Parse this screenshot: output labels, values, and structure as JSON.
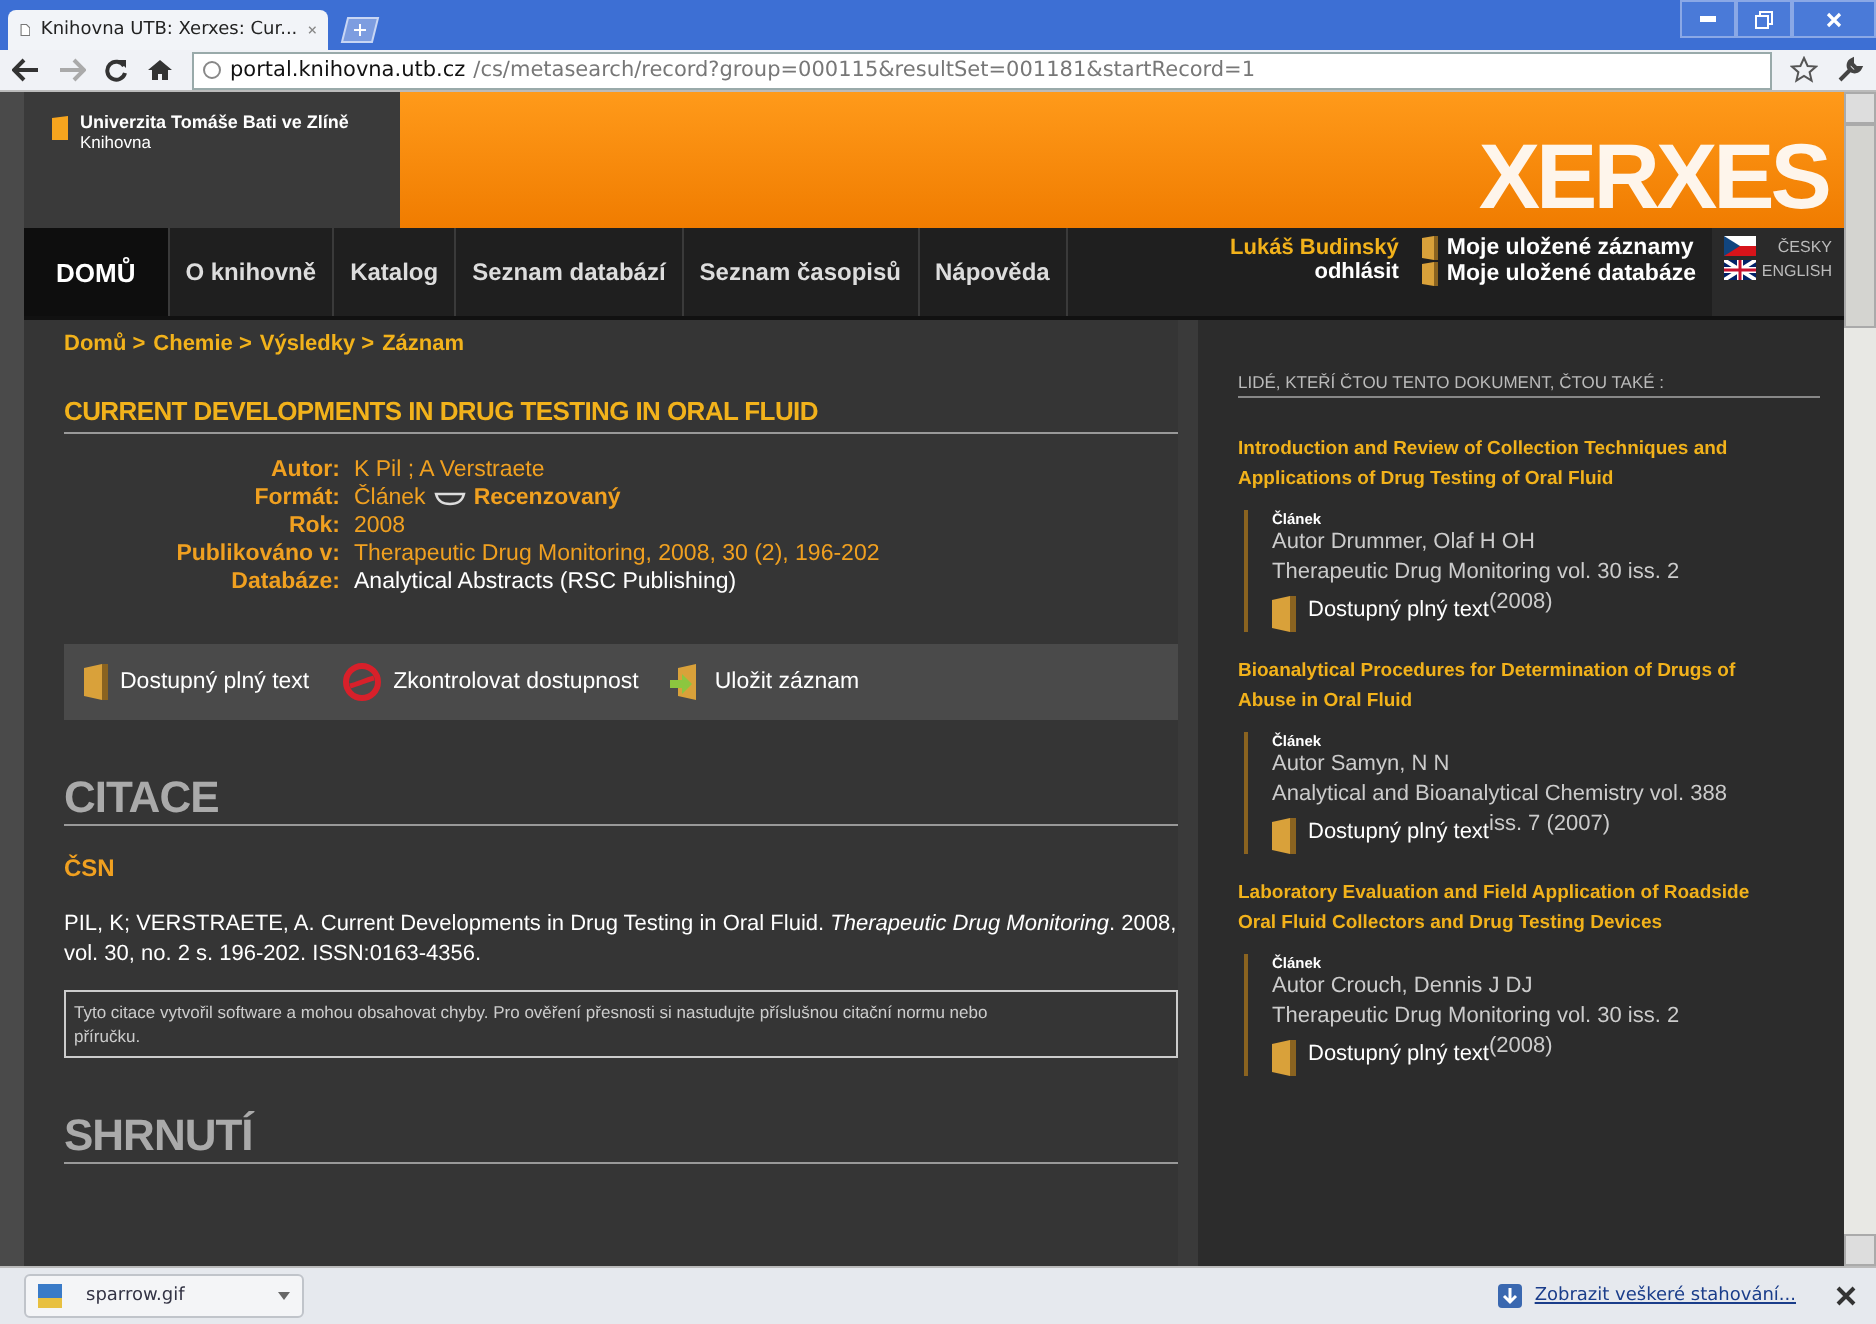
{
  "browser": {
    "tab_title": "Knihovna UTB: Xerxes: Cur...",
    "url_host": "portal.knihovna.utb.cz",
    "url_path": "/cs/metasearch/record?group=000115&resultSet=001181&startRecord=1"
  },
  "header": {
    "institution": "Univerzita Tomáše Bati ve Zlíně",
    "library": "Knihovna",
    "logo": "XERXES"
  },
  "nav": [
    {
      "label": "DOMŮ",
      "selected": true
    },
    {
      "label": "O knihovně",
      "selected": false
    },
    {
      "label": "Katalog",
      "selected": false
    },
    {
      "label": "Seznam databází",
      "selected": false
    },
    {
      "label": "Seznam časopisů",
      "selected": false
    },
    {
      "label": "Nápověda",
      "selected": false
    }
  ],
  "user": {
    "name": "Lukáš Budinský",
    "logout": "odhlásit",
    "saved_records": "Moje uložené záznamy",
    "saved_databases": "Moje uložené databáze"
  },
  "languages": [
    {
      "label": "ČESKY",
      "kind": "cz"
    },
    {
      "label": "ENGLISH",
      "kind": "uk"
    }
  ],
  "breadcrumb": [
    "Domů >",
    "Chemie >",
    "Výsledky >",
    "Záznam"
  ],
  "record": {
    "title": "CURRENT DEVELOPMENTS IN DRUG TESTING IN ORAL FLUID",
    "fields": [
      {
        "label": "Autor:",
        "value": "K Pil ; A Verstraete",
        "kind": "link"
      },
      {
        "label": "Formát:",
        "value": "Článek",
        "extra": "Recenzovaný",
        "kind": "format"
      },
      {
        "label": "Rok:",
        "value": "2008",
        "kind": "link"
      },
      {
        "label": "Publikováno v:",
        "value": "Therapeutic Drug Monitoring, 2008, 30 (2), 196-202",
        "kind": "link"
      },
      {
        "label": "Databáze:",
        "value": "Analytical Abstracts (RSC Publishing)",
        "kind": "plain"
      }
    ],
    "actions": [
      {
        "label": "Dostupný plný text",
        "kind": "fulltext"
      },
      {
        "label": "Zkontrolovat dostupnost",
        "kind": "check"
      },
      {
        "label": "Uložit záznam",
        "kind": "save"
      }
    ]
  },
  "citation": {
    "heading": "CITACE",
    "style": "ČSN",
    "text": "PIL, K; VERSTRAETE, A. Current Developments in Drug Testing in Oral Fluid. *Therapeutic Drug Monitoring*. 2008, vol. 30, no. 2 s. 196-202. ISSN:0163-4356.",
    "note": "Tyto citace vytvořil software a mohou obsahovat chyby. Pro ověření přesnosti si nastudujte příslušnou citační normu nebo příručku."
  },
  "summary": {
    "heading": "SHRNUTÍ"
  },
  "sidebar": {
    "heading": "LIDÉ, KTEŘÍ ČTOU TENTO DOKUMENT, ČTOU TAKÉ :",
    "items": [
      {
        "title": "Introduction and Review of Collection Techniques and Applications of Drug Testing of Oral Fluid",
        "type": "Článek",
        "author": "Autor Drummer, Olaf H OH",
        "journal": "Therapeutic Drug Monitoring vol. 30 iss. 2",
        "journal_tail": "(2008)",
        "fulltext": "Dostupný plný text"
      },
      {
        "title": "Bioanalytical Procedures for Determination of Drugs of Abuse in Oral Fluid",
        "type": "Článek",
        "author": "Autor Samyn, N N",
        "journal": "Analytical and Bioanalytical Chemistry vol. 388",
        "journal_tail": "iss. 7 (2007)",
        "fulltext": "Dostupný plný text"
      },
      {
        "title": "Laboratory Evaluation and Field Application of Roadside Oral Fluid Collectors and Drug Testing Devices",
        "type": "Článek",
        "author": "Autor Crouch, Dennis J DJ",
        "journal": "Therapeutic Drug Monitoring vol. 30 iss. 2",
        "journal_tail": "(2008)",
        "fulltext": "Dostupný plný text"
      }
    ]
  },
  "downloads": {
    "file": "sparrow.gif",
    "show_all": "Zobrazit veškeré stahování..."
  }
}
